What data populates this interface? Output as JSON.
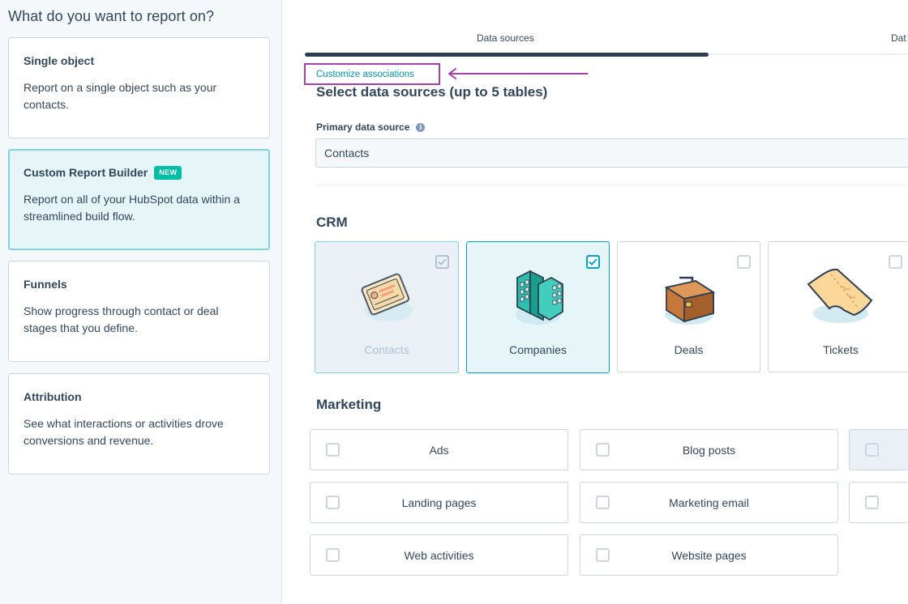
{
  "sidebar": {
    "heading": "What do you want to report on?",
    "cards": [
      {
        "title": "Single object",
        "desc": "Report on a single object such as your contacts."
      },
      {
        "title": "Custom Report Builder",
        "badge": "NEW",
        "desc": "Report on all of your HubSpot data within a streamlined build flow.",
        "selected": true
      },
      {
        "title": "Funnels",
        "desc": "Show progress through contact or deal stages that you define."
      },
      {
        "title": "Attribution",
        "desc": "See what interactions or activities drove conversions and revenue."
      }
    ]
  },
  "tabs": [
    {
      "label": "Data sources",
      "active": true
    },
    {
      "label": "Dat",
      "active": false
    }
  ],
  "customize_associations": "Customize associations",
  "select_title": "Select data sources (up to 5 tables)",
  "primary": {
    "label": "Primary data source",
    "value": "Contacts"
  },
  "crm": {
    "title": "CRM",
    "tiles": [
      {
        "label": "Contacts",
        "icon": "contacts-card-icon",
        "state": "disabled-checked"
      },
      {
        "label": "Companies",
        "icon": "buildings-icon",
        "state": "checked"
      },
      {
        "label": "Deals",
        "icon": "briefcase-icon",
        "state": "unchecked"
      },
      {
        "label": "Tickets",
        "icon": "ticket-icon",
        "state": "unchecked"
      }
    ]
  },
  "marketing": {
    "title": "Marketing",
    "tiles": [
      {
        "label": "Ads"
      },
      {
        "label": "Blog posts"
      },
      {
        "label": ""
      },
      {
        "label": "Landing pages"
      },
      {
        "label": "Marketing email"
      },
      {
        "label": ""
      },
      {
        "label": "Web activities"
      },
      {
        "label": "Website pages"
      }
    ]
  },
  "colors": {
    "accent": "#00a4bd",
    "highlight_box": "#a63ead",
    "badge": "#00bda5",
    "text": "#33475b"
  }
}
